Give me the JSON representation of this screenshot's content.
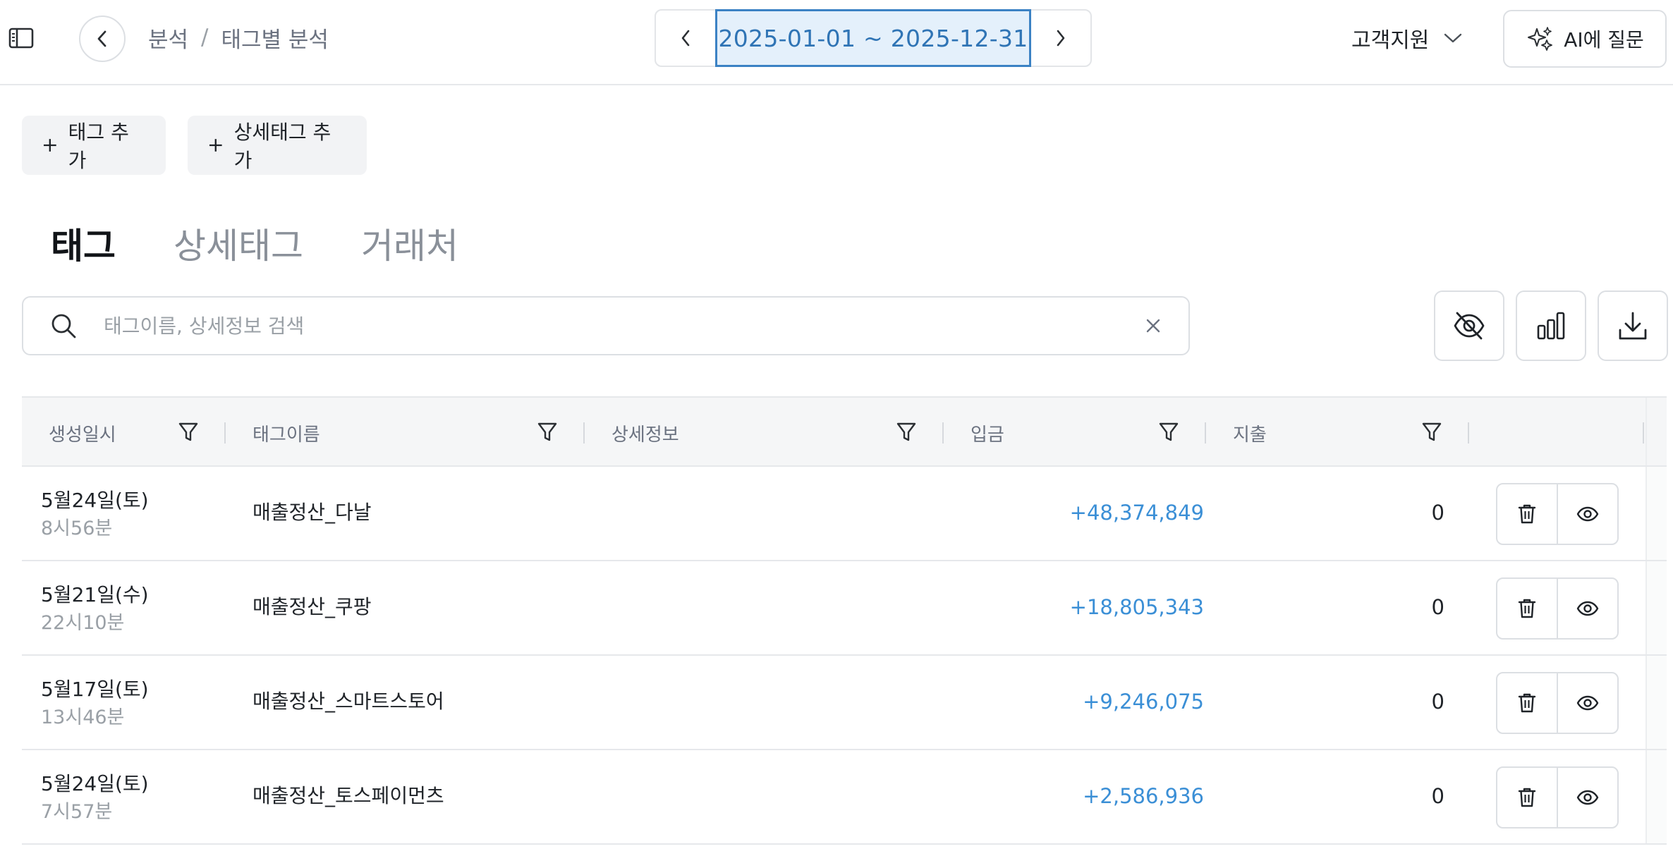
{
  "header": {
    "breadcrumb": [
      "분석",
      "태그별 분석"
    ],
    "breadcrumb_sep": "/",
    "date_range": "2025-01-01 ~ 2025-12-31",
    "support_label": "고객지원",
    "ai_label": "AI에 질문"
  },
  "actions": {
    "add_tag": "태그 추가",
    "add_subtag": "상세태그 추가"
  },
  "tabs": [
    {
      "label": "태그",
      "active": true
    },
    {
      "label": "상세태그",
      "active": false
    },
    {
      "label": "거래처",
      "active": false
    }
  ],
  "search": {
    "placeholder": "태그이름, 상세정보 검색",
    "value": ""
  },
  "table": {
    "columns": [
      "생성일시",
      "태그이름",
      "상세정보",
      "입금",
      "지출"
    ],
    "rows": [
      {
        "date": "5월24일(토)",
        "time": "8시56분",
        "name": "매출정산_다날",
        "detail": "",
        "deposit": "+48,374,849",
        "withdraw": "0"
      },
      {
        "date": "5월21일(수)",
        "time": "22시10분",
        "name": "매출정산_쿠팡",
        "detail": "",
        "deposit": "+18,805,343",
        "withdraw": "0"
      },
      {
        "date": "5월17일(토)",
        "time": "13시46분",
        "name": "매출정산_스마트스토어",
        "detail": "",
        "deposit": "+9,246,075",
        "withdraw": "0"
      },
      {
        "date": "5월24일(토)",
        "time": "7시57분",
        "name": "매출정산_토스페이먼츠",
        "detail": "",
        "deposit": "+2,586,936",
        "withdraw": "0"
      }
    ]
  },
  "colors": {
    "accent": "#3b82c4",
    "deposit": "#3b8fd6",
    "date_bg": "#e4f0fb"
  }
}
